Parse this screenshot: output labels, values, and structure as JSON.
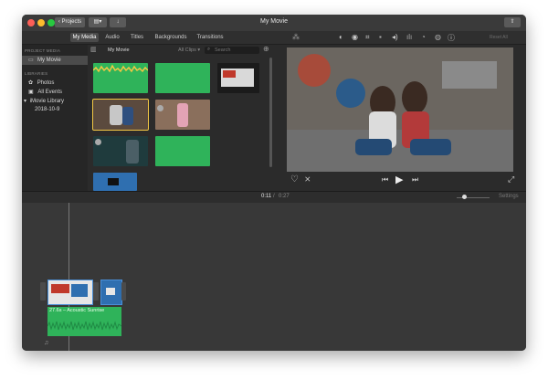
{
  "window": {
    "title": "My Movie"
  },
  "toolbar": {
    "projects_label": "Projects"
  },
  "tabs": [
    "My Media",
    "Audio",
    "Titles",
    "Backgrounds",
    "Transitions"
  ],
  "sidebar": {
    "project_media_header": "PROJECT MEDIA",
    "project_item": "My Movie",
    "libraries_header": "LIBRARIES",
    "items": [
      "Photos",
      "All Events",
      "iMovie Library",
      "2018-10-9"
    ]
  },
  "browser": {
    "title": "My Movie",
    "filter": "All Clips",
    "search_placeholder": "Search"
  },
  "viewer": {
    "reset_label": "Reset All"
  },
  "timeline": {
    "current_time": "0:11",
    "separator": "/",
    "total_time": "0:27",
    "settings_label": "Settings",
    "audio_clip_label": "27.6s – Acoustic Sunrise"
  },
  "colors": {
    "accent_green": "#2fb35a",
    "selection_yellow": "#f2c744",
    "close": "#fc5f57",
    "minimize": "#fdbc2e",
    "zoom": "#28c840"
  }
}
